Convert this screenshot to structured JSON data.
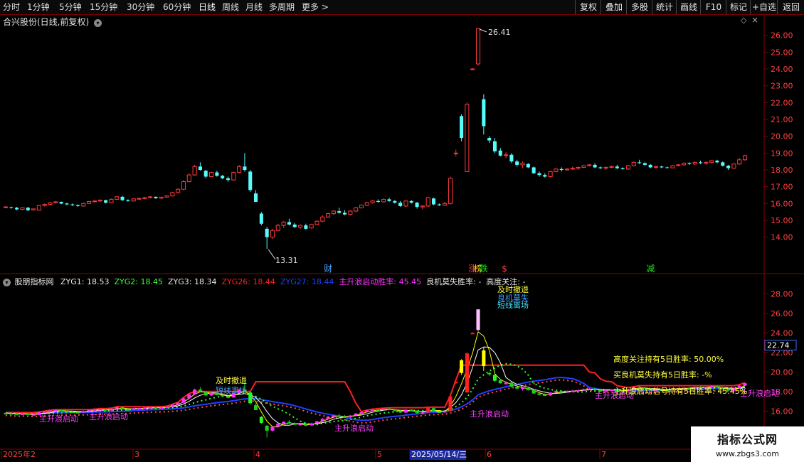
{
  "toolbar": {
    "periods": [
      "分时",
      "1分钟",
      "5分钟",
      "15分钟",
      "30分钟",
      "60分钟",
      "日线",
      "周线",
      "月线",
      "多周期",
      "更多 >"
    ],
    "active": "日线",
    "right": [
      "复权",
      "叠加",
      "多股",
      "统计",
      "画线",
      "F10",
      "标记",
      "+自选",
      "返回"
    ]
  },
  "main_chart": {
    "title": "合兴股份(日线,前复权)",
    "high_label": "26.41",
    "low_label": "13.31",
    "y_ticks": [
      "26.00",
      "25.00",
      "24.00",
      "23.00",
      "22.00",
      "21.00",
      "20.00",
      "19.00",
      "18.00",
      "17.00",
      "16.00",
      "15.00",
      "14.00"
    ],
    "events": [
      {
        "text": "财",
        "color": "#4aa8ff",
        "date": "2025-04-28"
      },
      {
        "text": "涨",
        "color": "#ff4040",
        "date": "2025-06-03"
      },
      {
        "text": "榜",
        "color": "#ffd000",
        "date": "2025-06-04"
      },
      {
        "text": "跌",
        "color": "#20e020",
        "date": "2025-06-05"
      },
      {
        "text": "$",
        "color": "#ff4040",
        "date": "2025-06-11"
      },
      {
        "text": "减",
        "color": "#20e020",
        "date": "2025-07-17"
      }
    ]
  },
  "indicator": {
    "name": "股朋指标网",
    "values": [
      {
        "text": "ZYG1: 18.53",
        "color": "#e8e8e8"
      },
      {
        "text": "ZYG2: 18.45",
        "color": "#3cff3c"
      },
      {
        "text": "ZYG3: 18.34",
        "color": "#e8e8e8"
      },
      {
        "text": "ZYG26: 18.44",
        "color": "#ff2020"
      },
      {
        "text": "ZYG27: 18.44",
        "color": "#2040ff"
      },
      {
        "text": "主升浪启动胜率: 45.45",
        "color": "#ff30ff"
      },
      {
        "text": "良机莫失胜率: -",
        "color": "#e8e8e8"
      },
      {
        "text": "高度关注: -",
        "color": "#e8e8e8"
      }
    ],
    "y_ticks": [
      "28.00",
      "26.00",
      "24.00",
      "22.00",
      "20.00",
      "18.00",
      "16.00"
    ],
    "current_value": "22.74",
    "stats": [
      {
        "text": "高度关注持有5日胜率: 50.00%",
        "color": "#ffff40"
      },
      {
        "text": "买良机莫失持有5日胜率: -%",
        "color": "#ffff40"
      },
      {
        "text": "主升浪启动信号持有5日胜率: 45.45%",
        "color": "#ffff40"
      }
    ],
    "signal_label": "主升浪启动",
    "labels": [
      {
        "text": "主升浪启动",
        "color": "#ff40ff"
      },
      {
        "text": "主升浪启动",
        "color": "#ff40ff"
      },
      {
        "text": "主升浪启动",
        "color": "#ff40ff"
      },
      {
        "text": "主升浪启动",
        "color": "#ff40ff"
      },
      {
        "text": "主升浪启动",
        "color": "#ff40ff"
      },
      {
        "text": "主升浪启动",
        "color": "#ff40ff"
      },
      {
        "text": "及时撤退",
        "color": "#ffff40"
      },
      {
        "text": "短线离场",
        "color": "#40a0ff"
      },
      {
        "text": "及时撤退",
        "color": "#ffff40"
      },
      {
        "text": "良机莫失",
        "color": "#40a0ff"
      },
      {
        "text": "短线离场",
        "color": "#40e0ff"
      }
    ]
  },
  "xaxis": {
    "labels": [
      "2025年2",
      "3",
      "4",
      "5",
      "2025/05/14/三",
      "6",
      "7"
    ]
  },
  "watermark": {
    "line1": "指标公式网",
    "line2": "www.zbgs3.com"
  },
  "chart_data": {
    "type": "candlestick",
    "title": "合兴股份(日线,前复权)",
    "ylim": [
      13.0,
      26.8
    ],
    "start_date": "2025-02-05",
    "ohlc": [
      [
        15.8,
        15.85,
        15.72,
        15.8
      ],
      [
        15.78,
        15.82,
        15.7,
        15.75
      ],
      [
        15.75,
        15.8,
        15.6,
        15.65
      ],
      [
        15.65,
        15.78,
        15.62,
        15.75
      ],
      [
        15.75,
        15.8,
        15.55,
        15.6
      ],
      [
        15.62,
        15.7,
        15.58,
        15.68
      ],
      [
        15.6,
        15.92,
        15.58,
        15.88
      ],
      [
        15.88,
        16.0,
        15.82,
        15.95
      ],
      [
        15.95,
        16.1,
        15.9,
        16.05
      ],
      [
        16.05,
        16.15,
        16.0,
        16.1
      ],
      [
        16.1,
        16.12,
        15.95,
        16.0
      ],
      [
        16.0,
        16.05,
        15.9,
        15.95
      ],
      [
        15.95,
        16.0,
        15.85,
        15.9
      ],
      [
        15.9,
        15.95,
        15.8,
        15.85
      ],
      [
        15.85,
        16.05,
        15.82,
        16.0
      ],
      [
        16.0,
        16.15,
        15.98,
        16.12
      ],
      [
        16.12,
        16.2,
        16.05,
        16.15
      ],
      [
        16.15,
        16.25,
        16.1,
        16.2
      ],
      [
        16.2,
        16.22,
        16.0,
        16.05
      ],
      [
        16.05,
        16.3,
        16.02,
        16.25
      ],
      [
        16.25,
        16.45,
        16.22,
        16.4
      ],
      [
        16.4,
        16.45,
        16.15,
        16.2
      ],
      [
        16.2,
        16.25,
        16.1,
        16.15
      ],
      [
        16.15,
        16.3,
        16.12,
        16.28
      ],
      [
        16.28,
        16.35,
        16.2,
        16.3
      ],
      [
        16.3,
        16.4,
        16.25,
        16.35
      ],
      [
        16.35,
        16.45,
        16.3,
        16.4
      ],
      [
        16.4,
        16.42,
        16.28,
        16.32
      ],
      [
        16.32,
        16.4,
        16.25,
        16.38
      ],
      [
        16.38,
        16.5,
        16.35,
        16.45
      ],
      [
        16.45,
        16.7,
        16.42,
        16.65
      ],
      [
        16.65,
        16.9,
        16.6,
        16.85
      ],
      [
        16.85,
        17.4,
        16.8,
        17.3
      ],
      [
        17.3,
        17.8,
        17.25,
        17.7
      ],
      [
        17.7,
        18.3,
        17.65,
        18.2
      ],
      [
        18.2,
        18.45,
        17.95,
        18.0
      ],
      [
        17.95,
        18.0,
        17.5,
        17.6
      ],
      [
        17.6,
        17.9,
        17.55,
        17.85
      ],
      [
        17.85,
        17.95,
        17.6,
        17.65
      ],
      [
        17.65,
        17.7,
        17.45,
        17.5
      ],
      [
        17.5,
        17.6,
        17.3,
        17.4
      ],
      [
        17.4,
        17.9,
        17.35,
        17.85
      ],
      [
        17.85,
        18.3,
        17.8,
        18.2
      ],
      [
        18.2,
        19.0,
        17.9,
        18.0
      ],
      [
        17.9,
        18.0,
        16.7,
        16.8
      ],
      [
        16.6,
        16.8,
        16.1,
        16.1
      ],
      [
        15.4,
        15.5,
        14.7,
        14.8
      ],
      [
        14.5,
        14.6,
        13.31,
        14.0
      ],
      [
        14.0,
        14.5,
        13.9,
        14.4
      ],
      [
        14.4,
        14.8,
        14.35,
        14.7
      ],
      [
        14.7,
        14.95,
        14.55,
        14.9
      ],
      [
        14.9,
        15.1,
        14.7,
        14.75
      ],
      [
        14.75,
        14.85,
        14.55,
        14.6
      ],
      [
        14.6,
        14.75,
        14.5,
        14.7
      ],
      [
        14.7,
        14.8,
        14.45,
        14.5
      ],
      [
        14.55,
        14.8,
        14.5,
        14.75
      ],
      [
        14.75,
        15.0,
        14.7,
        14.95
      ],
      [
        14.95,
        15.3,
        14.9,
        15.2
      ],
      [
        15.2,
        15.45,
        15.15,
        15.4
      ],
      [
        15.4,
        15.6,
        15.3,
        15.55
      ],
      [
        15.55,
        15.75,
        15.4,
        15.45
      ],
      [
        15.45,
        15.6,
        15.3,
        15.35
      ],
      [
        15.35,
        15.6,
        15.3,
        15.55
      ],
      [
        15.55,
        15.8,
        15.5,
        15.75
      ],
      [
        15.75,
        15.95,
        15.7,
        15.9
      ],
      [
        15.9,
        16.1,
        15.85,
        16.05
      ],
      [
        16.05,
        16.2,
        16.0,
        16.15
      ],
      [
        16.15,
        16.25,
        16.05,
        16.1
      ],
      [
        16.1,
        16.3,
        16.05,
        16.25
      ],
      [
        16.25,
        16.35,
        16.1,
        16.15
      ],
      [
        16.15,
        16.2,
        16.0,
        16.05
      ],
      [
        16.05,
        16.15,
        15.8,
        15.85
      ],
      [
        15.85,
        16.2,
        15.8,
        16.15
      ],
      [
        16.15,
        16.2,
        16.0,
        16.05
      ],
      [
        16.05,
        16.1,
        15.7,
        15.8
      ],
      [
        15.8,
        15.9,
        15.65,
        15.85
      ],
      [
        15.85,
        16.4,
        15.8,
        16.35
      ],
      [
        16.3,
        16.35,
        15.9,
        15.95
      ],
      [
        15.95,
        16.0,
        15.85,
        15.9
      ],
      [
        15.9,
        16.1,
        15.85,
        16.0
      ],
      [
        16.0,
        17.6,
        15.95,
        17.5
      ],
      [
        19.0,
        19.2,
        18.8,
        19.0
      ],
      [
        21.2,
        21.3,
        19.7,
        19.9
      ],
      [
        17.9,
        22.0,
        17.9,
        21.9
      ],
      [
        24.0,
        24.05,
        23.95,
        24.0
      ],
      [
        24.3,
        26.41,
        24.2,
        26.4
      ],
      [
        22.2,
        22.5,
        20.1,
        20.6
      ],
      [
        19.9,
        20.0,
        19.6,
        19.75
      ],
      [
        19.7,
        19.9,
        19.0,
        19.1
      ],
      [
        19.15,
        19.3,
        18.8,
        18.85
      ],
      [
        18.85,
        19.05,
        18.7,
        18.9
      ],
      [
        18.9,
        19.0,
        18.4,
        18.5
      ],
      [
        18.5,
        18.6,
        18.2,
        18.3
      ],
      [
        18.3,
        18.5,
        18.1,
        18.4
      ],
      [
        18.35,
        18.4,
        18.1,
        18.15
      ],
      [
        18.15,
        18.2,
        17.75,
        17.8
      ],
      [
        17.8,
        17.9,
        17.6,
        17.7
      ],
      [
        17.7,
        17.8,
        17.55,
        17.6
      ],
      [
        17.6,
        17.95,
        17.55,
        17.9
      ],
      [
        17.9,
        18.1,
        17.85,
        18.05
      ],
      [
        18.05,
        18.15,
        17.9,
        18.0
      ],
      [
        18.0,
        18.1,
        17.95,
        18.05
      ],
      [
        18.05,
        18.2,
        18.0,
        18.1
      ],
      [
        18.1,
        18.2,
        18.0,
        18.15
      ],
      [
        18.15,
        18.3,
        18.1,
        18.25
      ],
      [
        18.25,
        18.35,
        18.2,
        18.3
      ],
      [
        18.3,
        18.4,
        18.1,
        18.15
      ],
      [
        18.15,
        18.2,
        18.05,
        18.1
      ],
      [
        18.1,
        18.2,
        18.0,
        18.15
      ],
      [
        18.15,
        18.25,
        18.1,
        18.2
      ],
      [
        18.2,
        18.3,
        18.05,
        18.1
      ],
      [
        18.1,
        18.15,
        18.0,
        18.05
      ],
      [
        18.05,
        18.3,
        18.0,
        18.25
      ],
      [
        18.25,
        18.5,
        18.2,
        18.45
      ],
      [
        18.45,
        18.6,
        18.35,
        18.4
      ],
      [
        18.4,
        18.45,
        18.25,
        18.3
      ],
      [
        18.3,
        18.35,
        18.1,
        18.15
      ],
      [
        18.15,
        18.25,
        18.05,
        18.2
      ],
      [
        18.2,
        18.25,
        18.1,
        18.15
      ],
      [
        18.15,
        18.2,
        18.1,
        18.12
      ],
      [
        18.12,
        18.3,
        18.1,
        18.25
      ],
      [
        18.25,
        18.35,
        18.2,
        18.3
      ],
      [
        18.3,
        18.45,
        18.25,
        18.4
      ],
      [
        18.4,
        18.45,
        18.3,
        18.35
      ],
      [
        18.35,
        18.5,
        18.3,
        18.45
      ],
      [
        18.45,
        18.55,
        18.35,
        18.4
      ],
      [
        18.4,
        18.5,
        18.3,
        18.45
      ],
      [
        18.45,
        18.6,
        18.4,
        18.55
      ],
      [
        18.55,
        18.6,
        18.4,
        18.45
      ],
      [
        18.45,
        18.5,
        18.2,
        18.25
      ],
      [
        18.25,
        18.3,
        18.0,
        18.1
      ],
      [
        18.1,
        18.4,
        18.05,
        18.35
      ],
      [
        18.35,
        18.7,
        18.3,
        18.6
      ],
      [
        18.6,
        18.9,
        18.55,
        18.85
      ]
    ]
  }
}
